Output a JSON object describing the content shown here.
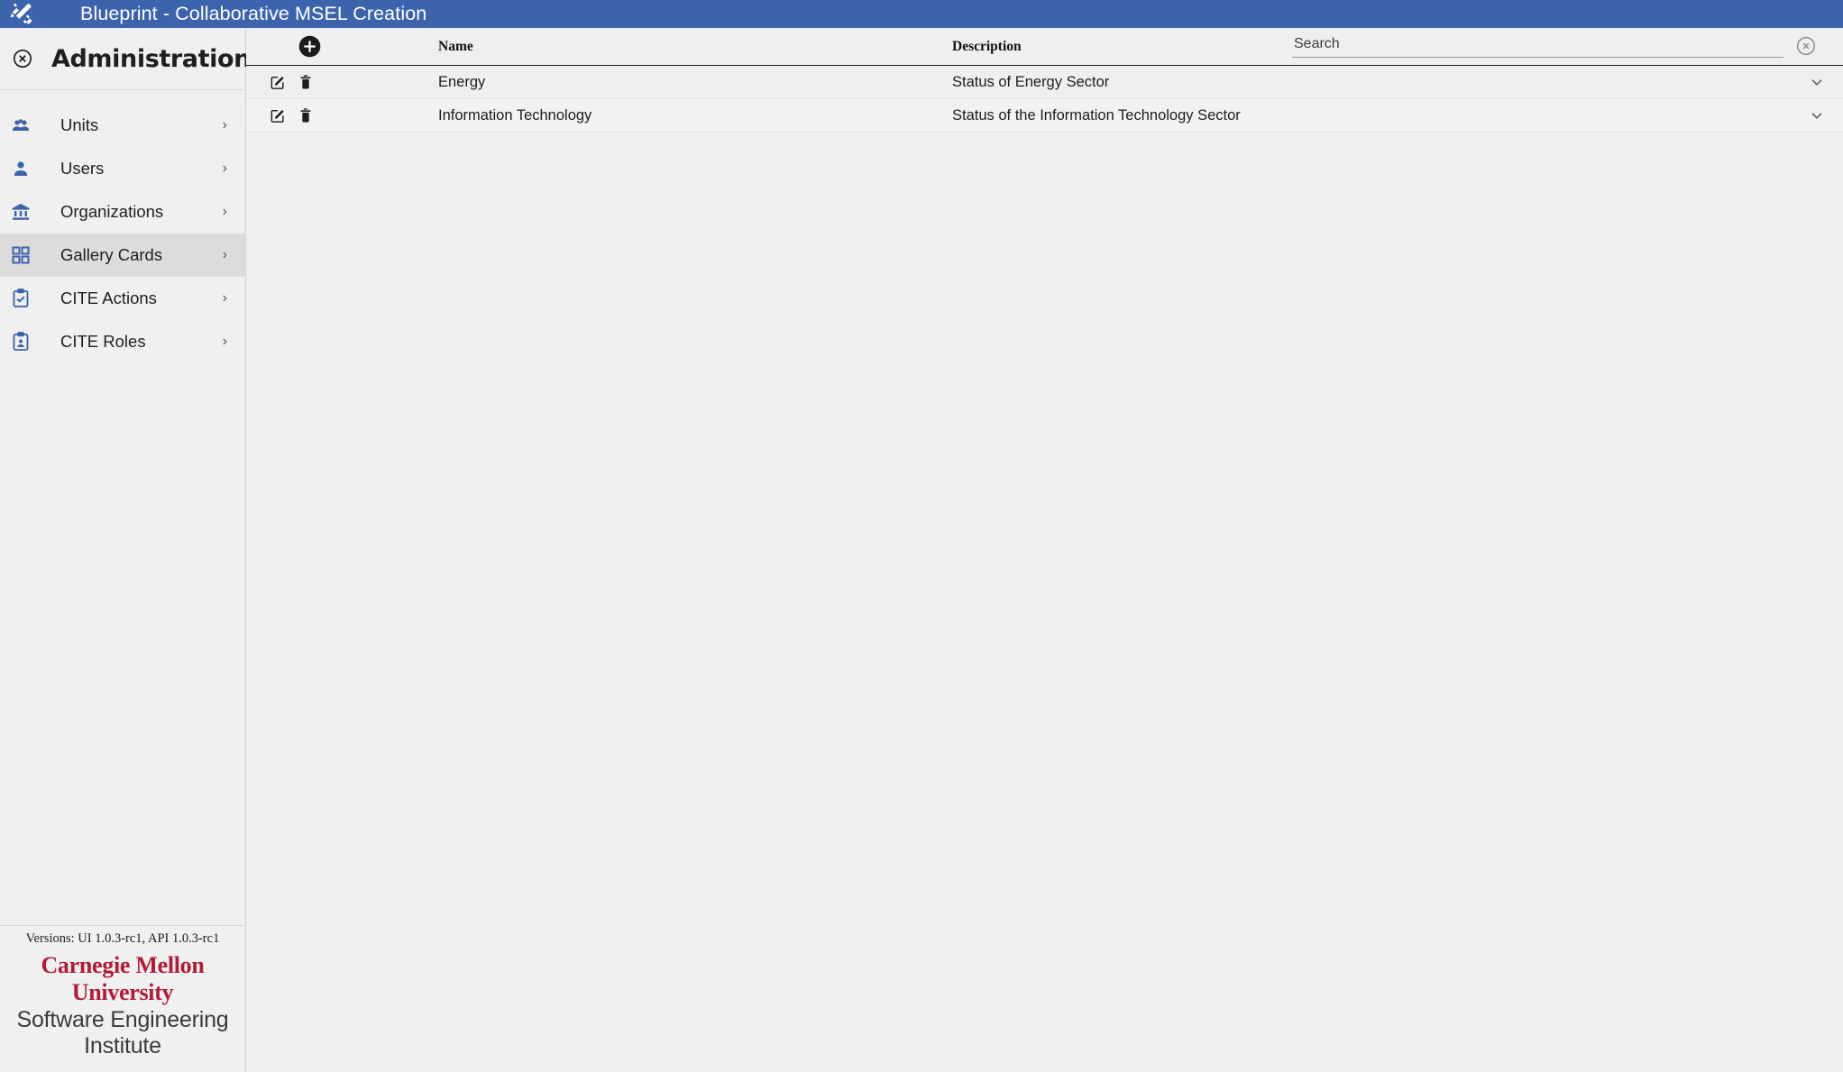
{
  "appbar": {
    "logo_icon": "design-tools-icon",
    "title": "Blueprint - Collaborative MSEL Creation",
    "background_color": "#3c64ad"
  },
  "sidebar": {
    "close_icon": "close-circle-icon",
    "title": "Administration",
    "items": [
      {
        "label": "Units",
        "icon": "group-people-icon",
        "chevron": "›",
        "active": false
      },
      {
        "label": "Users",
        "icon": "person-icon",
        "chevron": "›",
        "active": false
      },
      {
        "label": "Organizations",
        "icon": "bank-building-icon",
        "chevron": "›",
        "active": false
      },
      {
        "label": "Gallery Cards",
        "icon": "grid-cards-icon",
        "chevron": "›",
        "active": true
      },
      {
        "label": "CITE Actions",
        "icon": "clipboard-check-icon",
        "chevron": "›",
        "active": false
      },
      {
        "label": "CITE Roles",
        "icon": "clipboard-person-icon",
        "chevron": "›",
        "active": false
      }
    ],
    "footer": {
      "versions": "Versions: UI 1.0.3-rc1, API 1.0.3-rc1",
      "logo_line1": "Carnegie Mellon University",
      "logo_line2": "Software Engineering Institute",
      "logo_line1_color": "#b01c38"
    }
  },
  "main": {
    "add_icon": "add-circle-icon",
    "columns": {
      "name": "Name",
      "description": "Description"
    },
    "search": {
      "placeholder": "Search",
      "value": "",
      "clear_icon": "clear-circle-icon"
    },
    "rows": [
      {
        "edit_icon": "edit-square-icon",
        "delete_icon": "trash-icon",
        "name": "Energy",
        "description": "Status of Energy Sector",
        "expand_icon": "chevron-down-icon"
      },
      {
        "edit_icon": "edit-square-icon",
        "delete_icon": "trash-icon",
        "name": "Information Technology",
        "description": "Status of the Information Technology Sector",
        "expand_icon": "chevron-down-icon"
      }
    ]
  }
}
